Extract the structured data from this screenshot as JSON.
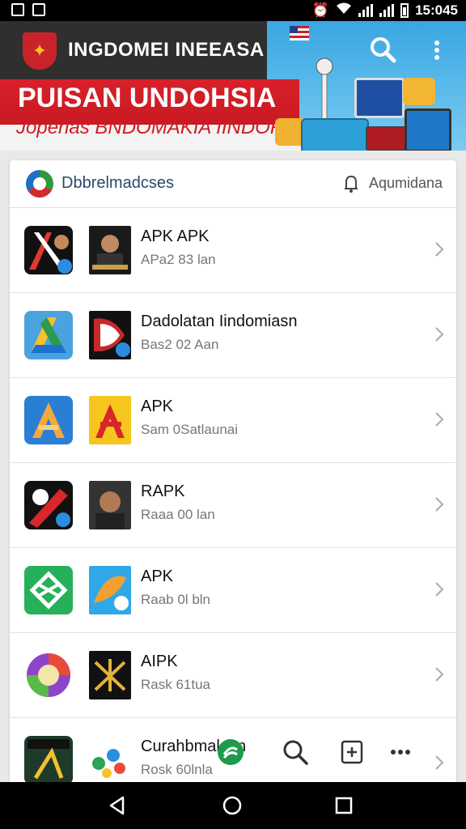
{
  "status_bar": {
    "time": "15:045",
    "icons": [
      "gallery-icon",
      "mail-icon",
      "alarm-icon",
      "wifi-icon",
      "signal-icon",
      "signal-icon",
      "battery-icon"
    ]
  },
  "header": {
    "title": "INGDOMEI INEEASA",
    "banner_title": "PUISAN UNDOHSIA",
    "banner_subtitle": "Joperias BNDOMAKIA IINDORDOIA"
  },
  "card": {
    "header_title": "Dbbrelmadcses",
    "header_action": "Aqumidana"
  },
  "items": [
    {
      "title": "APK APK",
      "subtitle": "APa2 83 lan"
    },
    {
      "title": "Dadolatan Iindomiasn",
      "subtitle": "Bas2 02 Aan"
    },
    {
      "title": "APK",
      "subtitle": "Sam 0Satlaunai"
    },
    {
      "title": "RAPK",
      "subtitle": "Raaa 00 lan"
    },
    {
      "title": "APK",
      "subtitle": "Raab 0l bln"
    },
    {
      "title": "AIPK",
      "subtitle": "Rask 61tua"
    },
    {
      "title": "Curahbmalasn",
      "subtitle": "Rosk 60lnla"
    }
  ],
  "colors": {
    "status_bar": "#000000",
    "header": "#2f2f2f",
    "banner_red": "#d8202a",
    "card_title": "#2b4a6b",
    "background": "#e9e9e9"
  }
}
